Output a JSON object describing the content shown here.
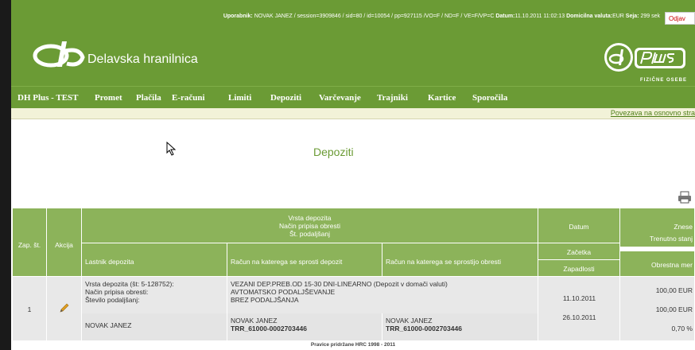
{
  "userbar": {
    "label_user": "Uporabnik:",
    "user_value": " NOVAK JANEZ  / session=3909846 / sid=80 / id=10054 / pp=927115 /VO=F / ND=F / VE=F/VP=C ",
    "label_date": "Datum:",
    "date_value": "11.10.2011 11:02:13 ",
    "label_currency": "Domicilna valuta:",
    "currency_value": "EUR ",
    "label_session": "Seja:",
    "session_value": " 299 sek",
    "logout": "Odjav"
  },
  "brand": {
    "bank_name": "Delavska hranilnica",
    "plus_sub": "FIZIČNE OSEBE"
  },
  "nav": {
    "items": [
      {
        "label": "DH Plus - TEST"
      },
      {
        "label": "Promet"
      },
      {
        "label": "Plačila"
      },
      {
        "label": "E-računi"
      },
      {
        "label": "Limiti"
      },
      {
        "label": "Depoziti"
      },
      {
        "label": "Varčevanje"
      },
      {
        "label": "Trajniki"
      },
      {
        "label": "Kartice"
      },
      {
        "label": "Sporočila"
      }
    ]
  },
  "topbar": {
    "link": "Povezava na osnovno stra"
  },
  "page": {
    "title": "Depoziti"
  },
  "table": {
    "h_zap": "Zap. št.",
    "h_akcija": "Akcija",
    "h_vrsta1": "Vrsta depozita",
    "h_vrsta2": "Način pripisa obresti",
    "h_vrsta3": "Št. podaljšanj",
    "h_lastnik": "Lastnik depozita",
    "h_racun_dep": "Račun na katerega se sprosti depozit",
    "h_racun_obr": "Račun na katerega se sprostijo obresti",
    "h_datum": "Datum",
    "h_zacetka": "Začetka",
    "h_zapadlosti": "Zapadlosti",
    "h_znesek": "Znese",
    "h_stanje": "Trenutno stanj",
    "h_mera": "Obrestna mer",
    "row": {
      "zap": "1",
      "lbl_vrsta": "Vrsta depozita (št: 5-128752):",
      "lbl_nacin": "Način pripisa obresti:",
      "lbl_stevilo": "Število podaljšanj:",
      "vrsta": "VEZANI DEP.PREB.OD 15-30 DNI-LINEARNO (Depozit v domači valuti)",
      "nacin": "AVTOMATSKO PODALJŠEVANJE",
      "stevilo": "BREZ PODALJŠANJA",
      "lastnik": "NOVAK JANEZ",
      "racun_dep_name": "NOVAK JANEZ",
      "racun_dep_trr": "TRR_61000-0002703446",
      "racun_obr_name": "NOVAK JANEZ",
      "racun_obr_trr": "TRR_61000-0002703446",
      "datum_zacetka": "11.10.2011",
      "datum_zapadlosti": "26.10.2011",
      "znesek": "100,00 EUR",
      "stanje": "100,00 EUR",
      "mera": "0,70 %"
    }
  },
  "footer": {
    "text": "Pravice pridržane HRC 1998 - 2011"
  }
}
